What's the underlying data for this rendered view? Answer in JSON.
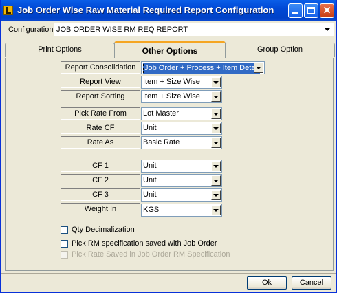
{
  "window": {
    "title": "Job Order Wise Raw Material Required Report Configuration",
    "minimize_label": "_",
    "maximize_label": "□",
    "close_label": "✕"
  },
  "configuration": {
    "label": "Configuration",
    "value": "JOB ORDER WISE RM REQ REPORT"
  },
  "tabs": [
    {
      "label": "Print Options",
      "active": false
    },
    {
      "label": "Other Options",
      "active": true
    },
    {
      "label": "Group Option",
      "active": false
    }
  ],
  "fields": {
    "report_consolidation": {
      "label": "Report Consolidation",
      "value": "Job Order + Process + Item Detail"
    },
    "report_view": {
      "label": "Report View",
      "value": "Item + Size Wise"
    },
    "report_sorting": {
      "label": "Report Sorting",
      "value": "Item + Size Wise"
    },
    "pick_rate_from": {
      "label": "Pick Rate From",
      "value": "Lot Master"
    },
    "rate_cf": {
      "label": "Rate CF",
      "value": "Unit"
    },
    "rate_as": {
      "label": "Rate As",
      "value": "Basic Rate"
    },
    "cf1": {
      "label": "CF 1",
      "value": "Unit"
    },
    "cf2": {
      "label": "CF 2",
      "value": "Unit"
    },
    "cf3": {
      "label": "CF 3",
      "value": "Unit"
    },
    "weight_in": {
      "label": "Weight In",
      "value": "KGS"
    }
  },
  "checkboxes": {
    "qty_decimalization": {
      "label": "Qty Decimalization",
      "checked": false,
      "enabled": true
    },
    "pick_rm_spec": {
      "label": "Pick RM specification saved with Job Order",
      "checked": false,
      "enabled": true
    },
    "pick_rate_saved": {
      "label": "Pick Rate  Saved in Job Order RM Specification",
      "checked": false,
      "enabled": false
    }
  },
  "buttons": {
    "ok": "Ok",
    "cancel": "Cancel"
  }
}
